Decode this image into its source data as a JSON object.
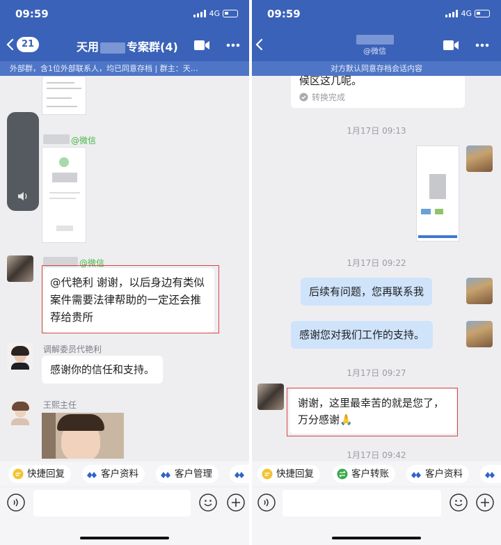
{
  "left": {
    "status": {
      "time": "09:59",
      "network": "4G"
    },
    "header": {
      "unread_badge": "21",
      "title_prefix": "天用",
      "title_suffix": "专案群(4)",
      "subtitle": "外部群，含1位外部联系人，均已同意存档 | 群主：天…"
    },
    "messages": {
      "wechat_label_1": "@微信",
      "wechat_label_2": "@微信",
      "client_message": "@代艳利 谢谢，以后身边有类似案件需要法律帮助的一定还会推荐给贵所",
      "mediator_name": "调解委员代艳利",
      "mediator_message": "感谢你的信任和支持。",
      "director_name": "王熙主任"
    },
    "chips": [
      "快捷回复",
      "客户资料",
      "客户管理"
    ]
  },
  "right": {
    "status": {
      "time": "09:59",
      "network": "4G"
    },
    "header": {
      "wechat_tag": "@微信",
      "subtitle": "对方默认同意存档会话内容"
    },
    "messages": {
      "partial_text": "候区这几呢。",
      "converted_label": "转换完成",
      "time_1": "1月17日 09:13",
      "time_2": "1月17日 09:22",
      "msg_followup": "后续有问题，您再联系我",
      "msg_thanks_support": "感谢您对我们工作的支持。",
      "time_3": "1月17日 09:27",
      "client_reply": "谢谢，这里最幸苦的就是您了，万分感谢🙏",
      "time_4": "1月17日 09:42"
    },
    "chips": [
      "快捷回复",
      "客户转账",
      "客户资料"
    ]
  },
  "colors": {
    "header_blue": "#3a62b8",
    "subbar_blue": "#4f76c6",
    "chat_bg": "#eeeef1",
    "sent_bubble": "#cfe3fb",
    "highlight_red": "#d9453f",
    "wechat_green": "#46b648"
  },
  "icons": [
    "back-icon",
    "video-call-icon",
    "more-icon",
    "voice-input-icon",
    "emoji-icon",
    "plus-icon",
    "converted-check-icon",
    "speaker-icon"
  ]
}
